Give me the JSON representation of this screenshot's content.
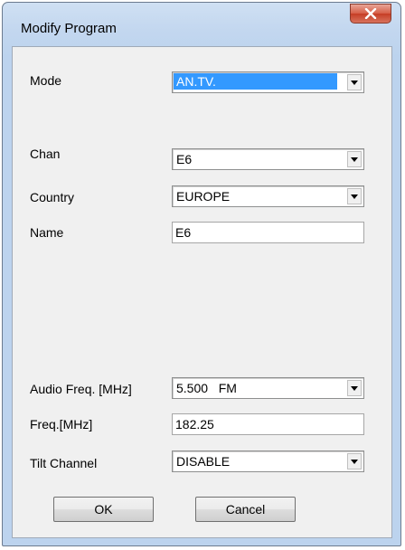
{
  "window": {
    "title": "Modify Program"
  },
  "fields": {
    "mode": {
      "label": "Mode",
      "value": "AN.TV."
    },
    "chan": {
      "label": "Chan",
      "value": "E6"
    },
    "country": {
      "label": "Country",
      "value": "EUROPE"
    },
    "name": {
      "label": "Name",
      "value": "E6"
    },
    "audio_freq": {
      "label": "Audio Freq. [MHz]",
      "value": "5.500   FM"
    },
    "freq": {
      "label": "Freq.[MHz]",
      "value": "182.25"
    },
    "tilt_channel": {
      "label": "Tilt Channel",
      "value": "DISABLE"
    }
  },
  "buttons": {
    "ok": "OK",
    "cancel": "Cancel"
  },
  "colors": {
    "selection": "#3399ff",
    "close_button": "#c53d25",
    "dialog_bg": "#f0f0f0",
    "frame": "#bcd3ee"
  },
  "icons": {
    "close": "close-x-icon",
    "dropdown": "dropdown-arrow-icon"
  }
}
